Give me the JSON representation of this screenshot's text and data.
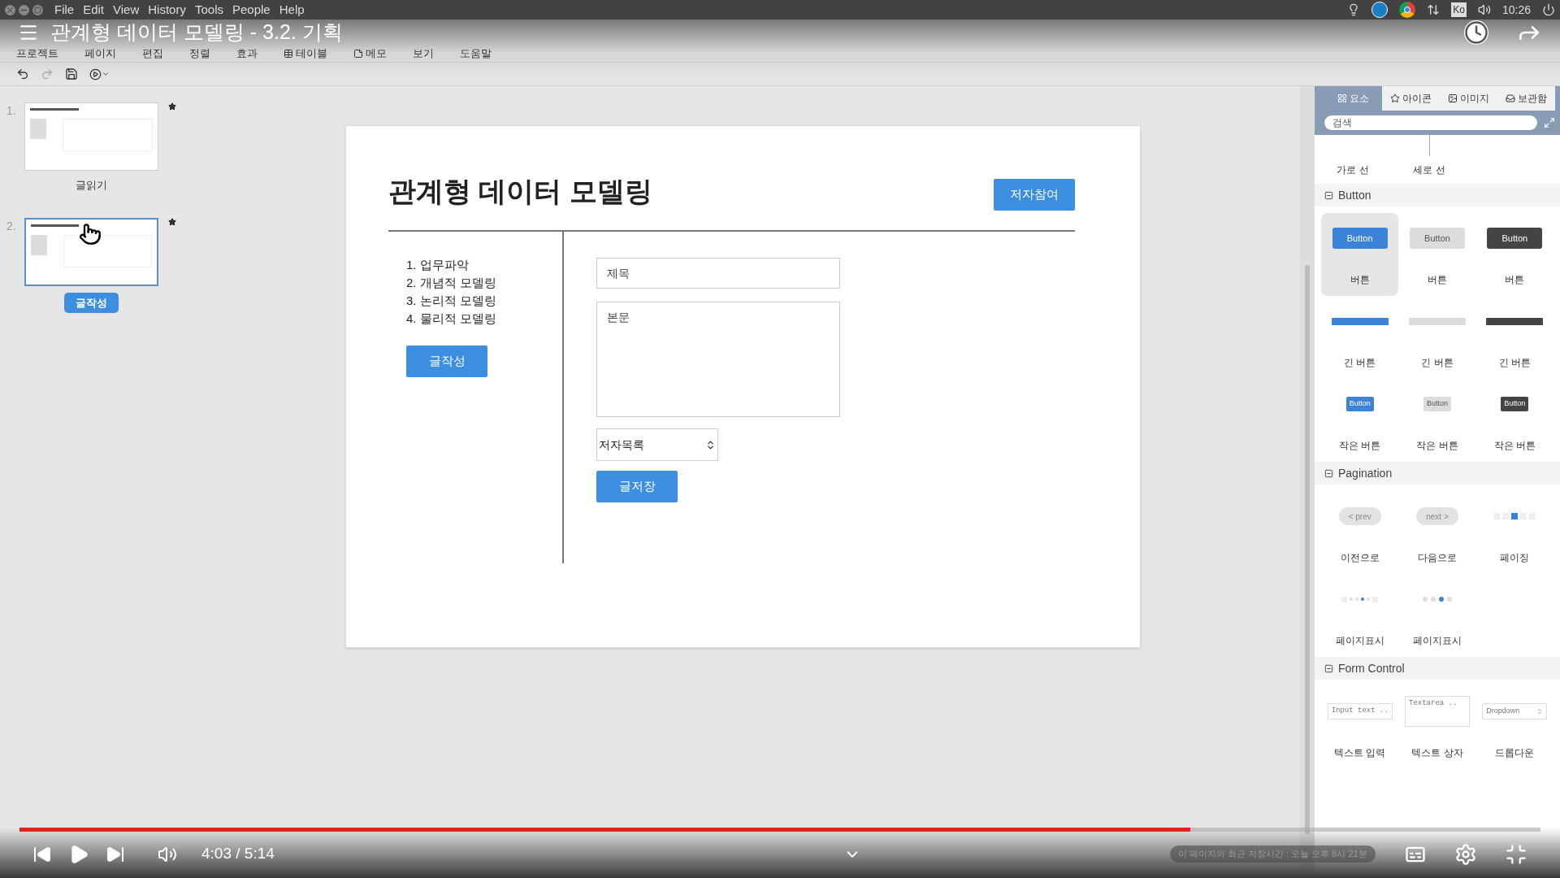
{
  "os_menu": [
    "File",
    "Edit",
    "View",
    "History",
    "Tools",
    "People",
    "Help"
  ],
  "tray": {
    "keyboard": "Ko",
    "time": "10:26"
  },
  "video_title": "관계형 데이터 모델링 - 3.2. 기획",
  "app_menu": [
    {
      "label": "프로젝트",
      "kind": "text"
    },
    {
      "label": "페이지",
      "kind": "text"
    },
    {
      "label": "편집",
      "kind": "text"
    },
    {
      "label": "정렬",
      "kind": "text"
    },
    {
      "label": "효과",
      "kind": "text"
    },
    {
      "label": "테이블",
      "kind": "table"
    },
    {
      "label": "메모",
      "kind": "memo"
    },
    {
      "label": "보기",
      "kind": "text"
    },
    {
      "label": "도움말",
      "kind": "text"
    }
  ],
  "pages": [
    {
      "number": "1.",
      "label": "글읽기",
      "selected": false
    },
    {
      "number": "2.",
      "label": "글작성",
      "selected": true
    }
  ],
  "slide": {
    "title": "관계형 데이터 모델링",
    "author_button": "저자참여",
    "steps": [
      "1. 업무파악",
      "2. 개념적 모델링",
      "3. 논리적 모델링",
      "4. 물리적 모델링"
    ],
    "write_button": "글작성",
    "title_placeholder": "제목",
    "body_placeholder": "본문",
    "author_select": "저자목록",
    "save_button": "글저장"
  },
  "palette": {
    "tabs": [
      {
        "label": "요소",
        "kind": "grid",
        "selected": true
      },
      {
        "label": "아이콘",
        "kind": "star",
        "selected": false
      },
      {
        "label": "이미지",
        "kind": "image",
        "selected": false
      },
      {
        "label": "보관함",
        "kind": "inbox",
        "selected": false
      }
    ],
    "search_placeholder": "검색",
    "lines": [
      "가로 선",
      "세로 선"
    ],
    "sections": [
      {
        "title": "Button",
        "items": [
          {
            "kind": "button",
            "sample": "Button",
            "label": "버튼",
            "selected": true
          },
          {
            "kind": "button",
            "sample": "Button",
            "label": "버튼",
            "selected": false
          },
          {
            "kind": "button",
            "sample": "Button",
            "label": "버튼",
            "selected": false
          },
          {
            "kind": "long",
            "label": "긴 버튼",
            "selected": false
          },
          {
            "kind": "long",
            "label": "긴 버튼",
            "selected": false
          },
          {
            "kind": "long",
            "label": "긴 버튼",
            "selected": false
          },
          {
            "kind": "small",
            "sample": "Button",
            "label": "작은 버튼",
            "selected": false
          },
          {
            "kind": "small",
            "sample": "Button",
            "label": "작은 버튼",
            "selected": false
          },
          {
            "kind": "small",
            "sample": "Button",
            "label": "작은 버튼",
            "selected": false
          }
        ]
      },
      {
        "title": "Pagination",
        "items": [
          {
            "kind": "pill",
            "sample": "< prev",
            "label": "이전으로",
            "selected": false
          },
          {
            "kind": "pill",
            "sample": "next >",
            "label": "다음으로",
            "selected": false
          },
          {
            "kind": "paging",
            "label": "페이징",
            "selected": false
          },
          {
            "kind": "dots_arrows",
            "label": "페이지표시",
            "selected": false
          },
          {
            "kind": "dots",
            "label": "페이지표시",
            "selected": false
          }
        ]
      },
      {
        "title": "Form Control",
        "items": [
          {
            "kind": "input",
            "sample": "Input text ..",
            "label": "텍스트 입력",
            "selected": false
          },
          {
            "kind": "textarea",
            "sample": "Textarea ..",
            "label": "텍스트 상자",
            "selected": false
          },
          {
            "kind": "dropdown",
            "sample": "Dropdown",
            "label": "드롭다운",
            "selected": false
          }
        ]
      }
    ]
  },
  "player": {
    "progress": {
      "level": 0.77
    },
    "time": "4:03 / 5:14",
    "save_status": "이 페이지의 최근 저장시간 : 오늘 오후 8시 21분"
  }
}
